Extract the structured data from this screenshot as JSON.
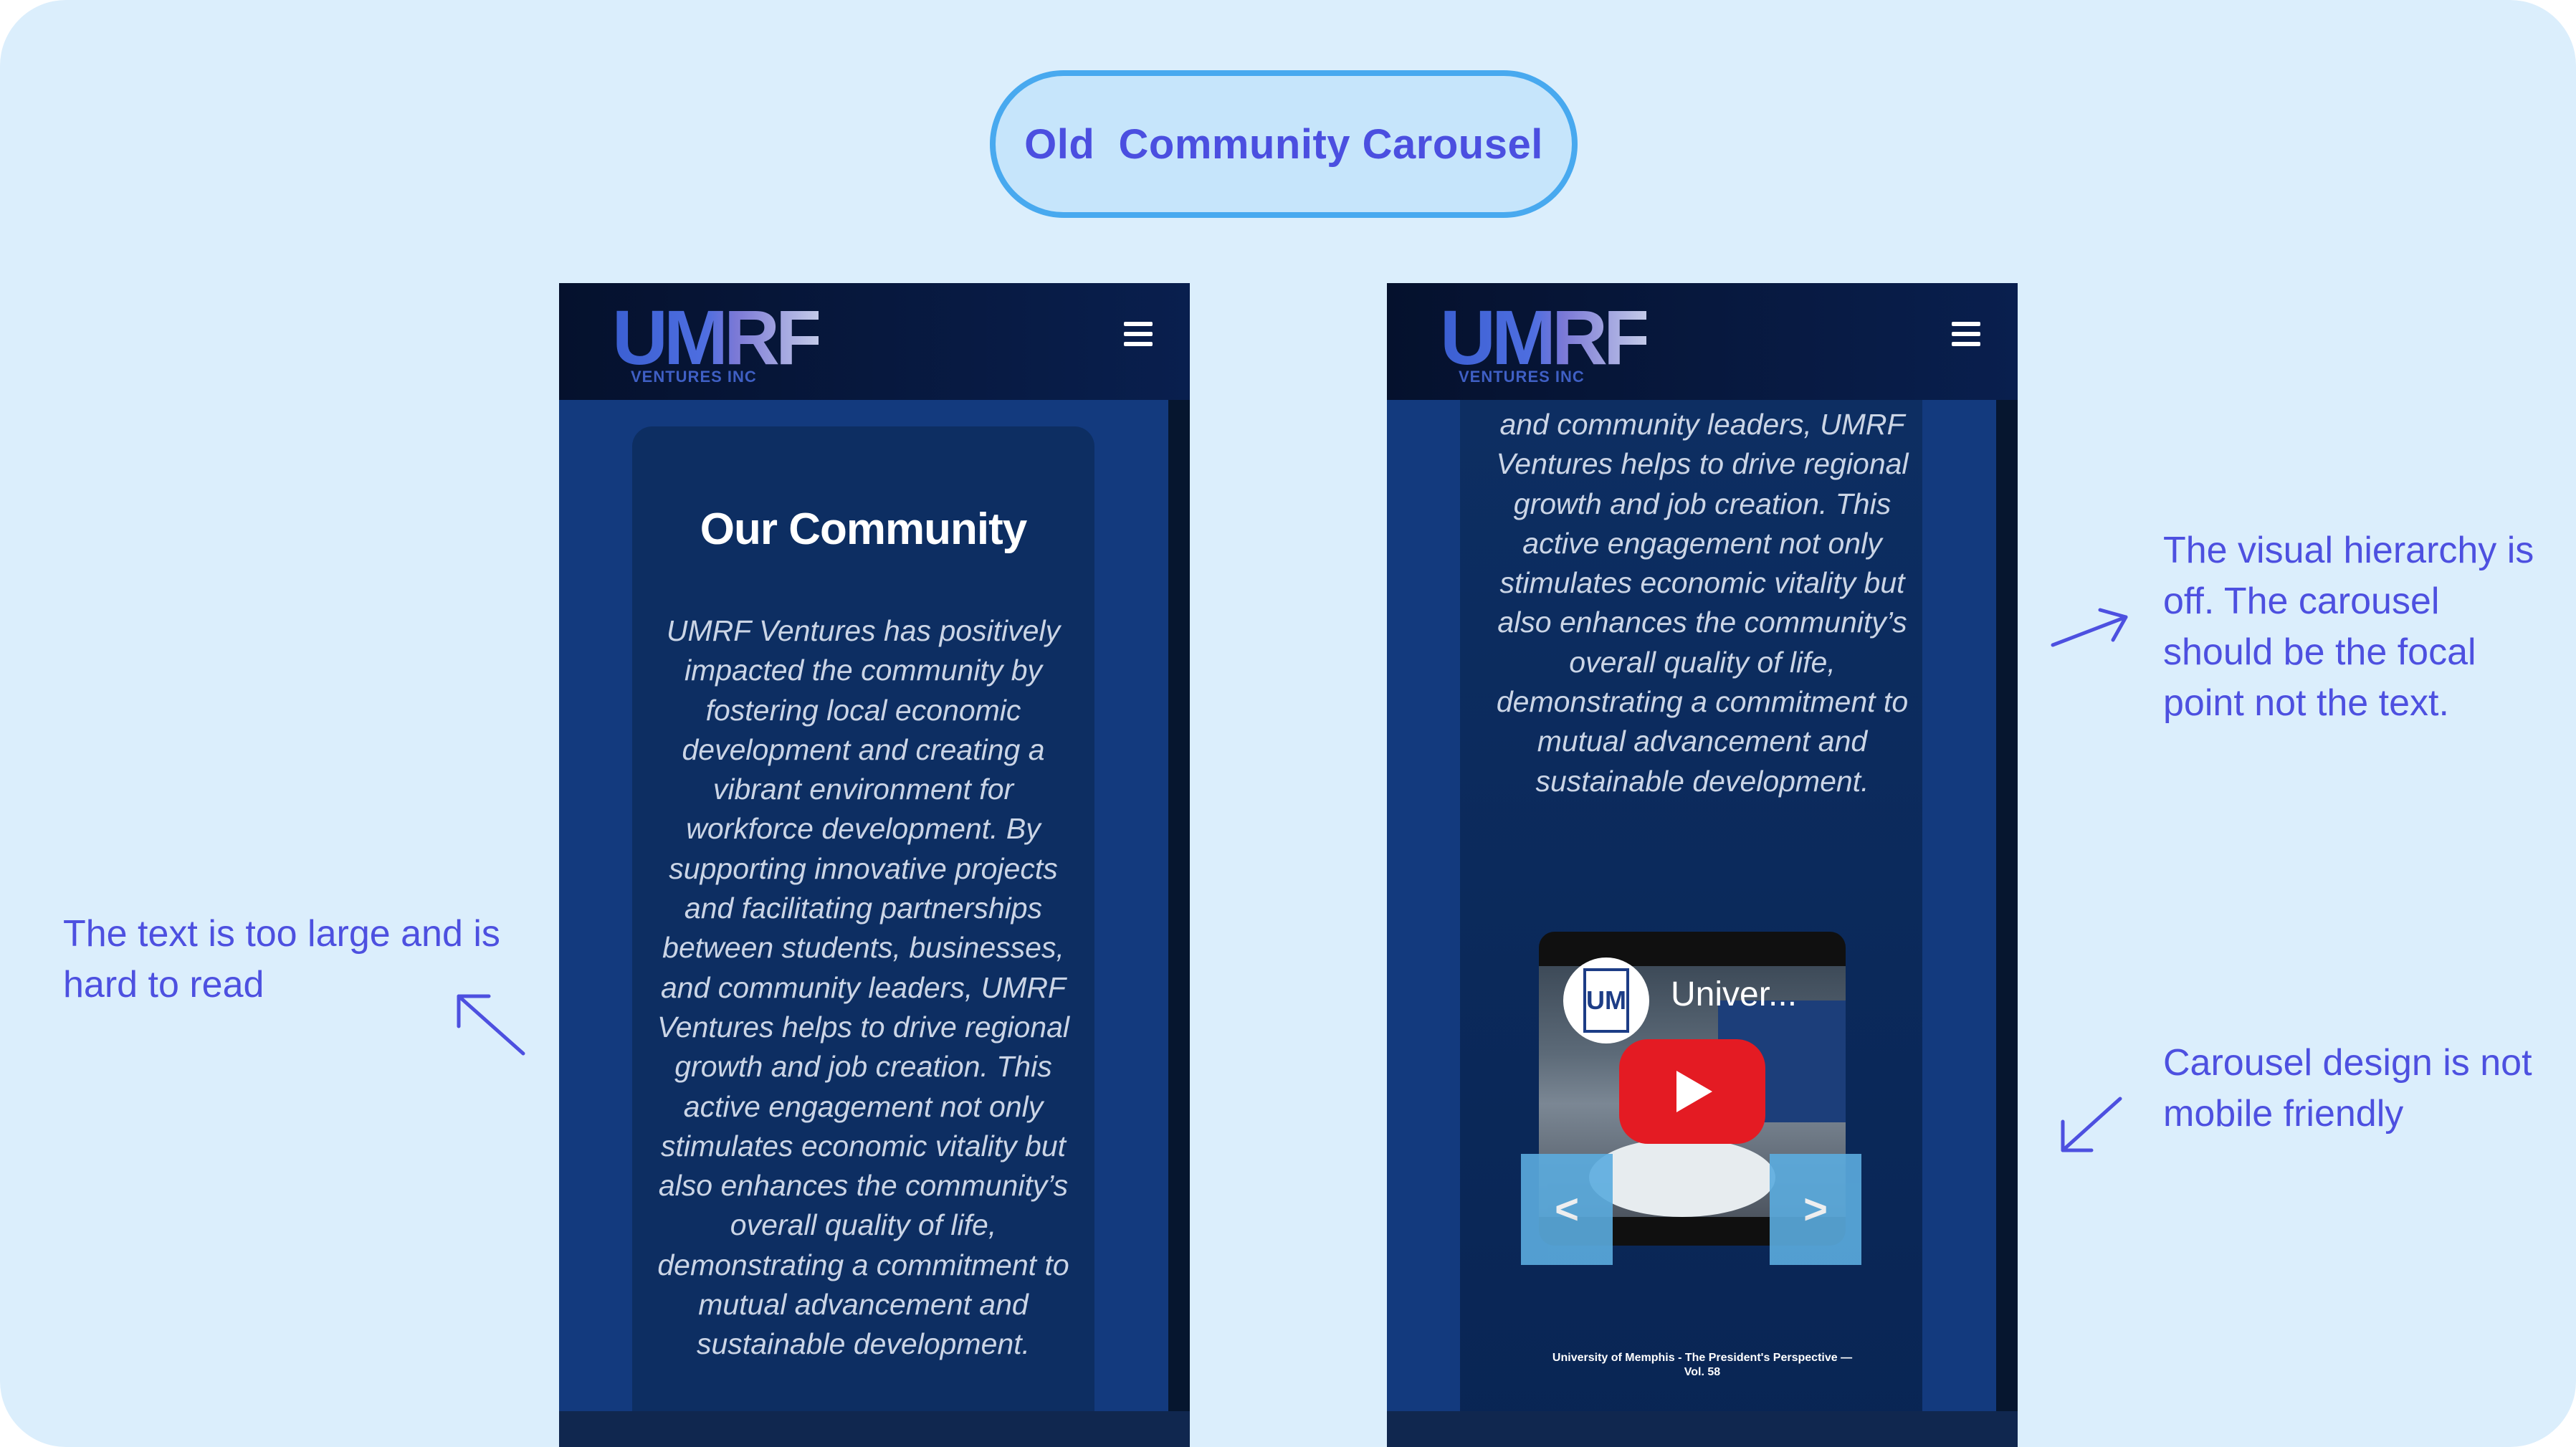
{
  "title": "Old  Community Carousel",
  "annotations": {
    "left": [
      "The text is too large and is",
      "hard to read"
    ],
    "right_top": [
      "The visual hierarchy is",
      "off. The carousel",
      "should be the focal",
      "point not the text."
    ],
    "right_bottom": [
      "Carousel design is not",
      "mobile friendly"
    ]
  },
  "brand": {
    "logo_main": "UMRF",
    "logo_sub": "VENTURES INC"
  },
  "phone1": {
    "heading": "Our Community",
    "lines": [
      "UMRF Ventures has positively",
      "impacted the community by",
      "fostering local economic",
      "development and creating a",
      "vibrant environment for",
      "workforce development. By",
      "supporting innovative projects",
      "and facilitating partnerships",
      "between students, businesses,",
      "and community leaders, UMRF",
      "Ventures helps to drive regional",
      "growth and job creation. This",
      "active engagement not only",
      "stimulates economic vitality but",
      "also enhances the community’s",
      "overall quality of life,",
      "demonstrating a commitment to",
      "mutual advancement and",
      "sustainable development."
    ]
  },
  "phone2": {
    "lines": [
      "and community leaders, UMRF",
      "Ventures helps to drive regional",
      "growth and job creation. This",
      "active engagement not only",
      "stimulates economic vitality but",
      "also enhances the community’s",
      "overall quality of life,",
      "demonstrating a commitment to",
      "mutual advancement and",
      "sustainable development."
    ],
    "video": {
      "channel_letters": "UM",
      "title": "Univer..."
    },
    "prev_label": "<",
    "next_label": ">",
    "caption_line1": "University of Memphis - The President's Perspective —",
    "caption_line2": "Vol. 58"
  },
  "colors": {
    "annotation": "#4d50e0",
    "pill_border": "#48a9ef",
    "page_bg": "#dbeefc",
    "phone_blue": "#133a7e",
    "youtube_red": "#e41b23"
  }
}
